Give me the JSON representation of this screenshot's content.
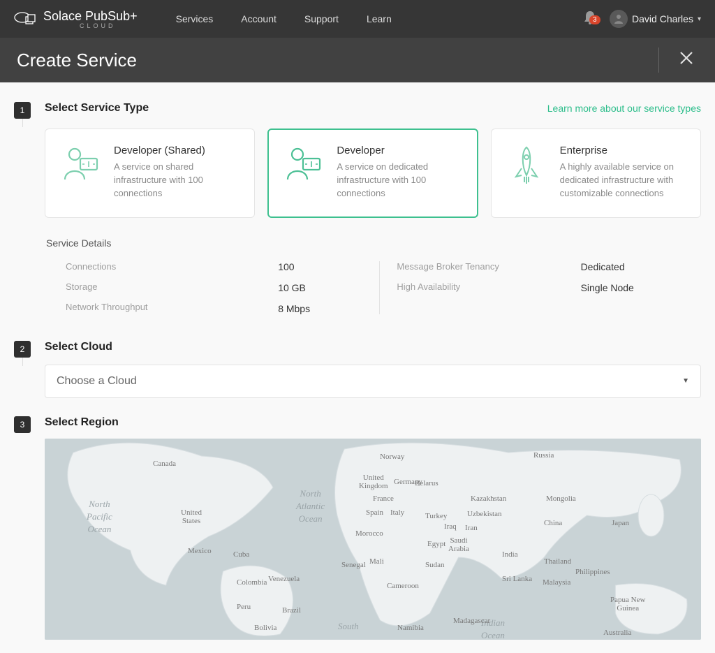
{
  "brand": {
    "name": "Solace PubSub+",
    "sub": "CLOUD"
  },
  "nav": {
    "items": [
      "Services",
      "Account",
      "Support",
      "Learn"
    ]
  },
  "notifications": {
    "count": "3"
  },
  "user": {
    "name": "David Charles"
  },
  "page": {
    "title": "Create Service"
  },
  "step1": {
    "title": "Select Service Type",
    "learn_link": "Learn more about our service types",
    "cards": [
      {
        "title": "Developer (Shared)",
        "desc": "A service on shared infrastructure with 100 connections"
      },
      {
        "title": "Developer",
        "desc": "A service on dedicated infrastructure with 100 connections"
      },
      {
        "title": "Enterprise",
        "desc": "A highly available service on dedicated infrastructure with customizable connections"
      }
    ],
    "details_title": "Service Details",
    "details": {
      "connections_label": "Connections",
      "connections_val": "100",
      "storage_label": "Storage",
      "storage_val": "10 GB",
      "throughput_label": "Network Throughput",
      "throughput_val": "8 Mbps",
      "tenancy_label": "Message Broker Tenancy",
      "tenancy_val": "Dedicated",
      "ha_label": "High Availability",
      "ha_val": "Single Node"
    }
  },
  "step2": {
    "title": "Select Cloud",
    "placeholder": "Choose a Cloud"
  },
  "step3": {
    "title": "Select Region"
  },
  "map": {
    "oceans": {
      "npacific": "North\nPacific\nOcean",
      "natlantic": "North\nAtlantic\nOcean",
      "southatl": "South",
      "indian": "Indian\nOcean"
    },
    "countries": {
      "canada": "Canada",
      "russia": "Russia",
      "us": "United\nStates",
      "mexico": "Mexico",
      "norway": "Norway",
      "uk": "United\nKingdom",
      "germany": "Germany",
      "belarus": "Belarus",
      "france": "France",
      "spain": "Spain",
      "italy": "Italy",
      "turkey": "Turkey",
      "kazakhstan": "Kazakhstan",
      "uzbekistan": "Uzbekistan",
      "mongolia": "Mongolia",
      "china": "China",
      "japan": "Japan",
      "india": "India",
      "thailand": "Thailand",
      "philippines": "Philippines",
      "morocco": "Morocco",
      "egypt": "Egypt",
      "saudi": "Saudi\nArabia",
      "iraq": "Iraq",
      "iran": "Iran",
      "mali": "Mali",
      "senegal": "Senegal",
      "sudan": "Sudan",
      "cameroon": "Cameroon",
      "srilanka": "Sri Lanka",
      "malaysia": "Malaysia",
      "png": "Papua New\nGuinea",
      "colombia": "Colombia",
      "venezuela": "Venezuela",
      "peru": "Peru",
      "brazil": "Brazil",
      "bolivia": "Bolivia",
      "cuba": "Cuba",
      "namibia": "Namibia",
      "madagascar": "Madagascar",
      "australia": "Australia"
    }
  }
}
